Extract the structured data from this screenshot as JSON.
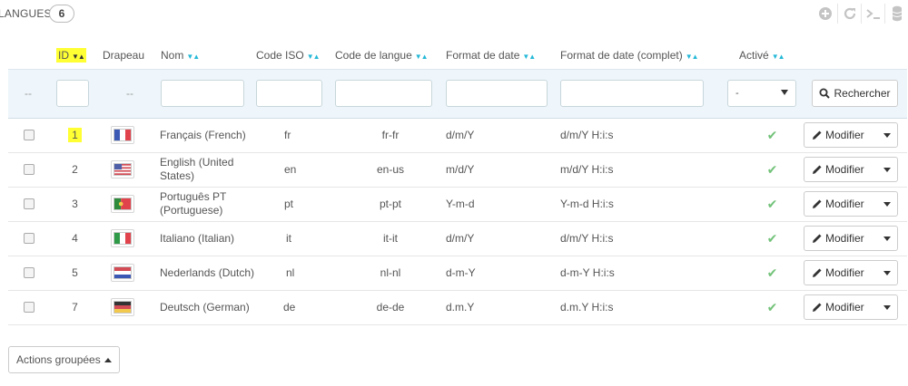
{
  "panel": {
    "title": "LANGUES",
    "count": "6"
  },
  "toolbar": {
    "icons": [
      "add-icon",
      "refresh-icon",
      "terminal-icon",
      "database-icon"
    ]
  },
  "columns": {
    "id": "ID",
    "flag": "Drapeau",
    "name": "Nom",
    "iso": "Code ISO",
    "lang_code": "Code de langue",
    "date_format": "Format de date",
    "date_format_full": "Format de date (complet)",
    "active": "Activé"
  },
  "filters": {
    "id_dash": "--",
    "flag_dash": "--",
    "active_select": "-",
    "search_label": "Rechercher"
  },
  "rows": [
    {
      "id": "1",
      "name": "Français (French)",
      "iso": "fr",
      "lang_code": "fr-fr",
      "date_format": "d/m/Y",
      "date_format_full": "d/m/Y H:i:s",
      "flag": "france"
    },
    {
      "id": "2",
      "name": "English (United States)",
      "iso": "en",
      "lang_code": "en-us",
      "date_format": "m/d/Y",
      "date_format_full": "m/d/Y H:i:s",
      "flag": "usa"
    },
    {
      "id": "3",
      "name": "Português PT (Portuguese)",
      "iso": "pt",
      "lang_code": "pt-pt",
      "date_format": "Y-m-d",
      "date_format_full": "Y-m-d H:i:s",
      "flag": "portugal"
    },
    {
      "id": "4",
      "name": "Italiano (Italian)",
      "iso": "it",
      "lang_code": "it-it",
      "date_format": "d/m/Y",
      "date_format_full": "d/m/Y H:i:s",
      "flag": "italy"
    },
    {
      "id": "5",
      "name": "Nederlands (Dutch)",
      "iso": "nl",
      "lang_code": "nl-nl",
      "date_format": "d-m-Y",
      "date_format_full": "d-m-Y H:i:s",
      "flag": "netherlands"
    },
    {
      "id": "7",
      "name": "Deutsch (German)",
      "iso": "de",
      "lang_code": "de-de",
      "date_format": "d.m.Y",
      "date_format_full": "d.m.Y H:i:s",
      "flag": "germany"
    }
  ],
  "row_action": "Modifier",
  "bulk_actions": "Actions groupées",
  "colors": {
    "accent": "#25b9d7",
    "active_check": "#72c279",
    "highlight": "#ffff33",
    "filter_bg": "#eef6fb"
  }
}
